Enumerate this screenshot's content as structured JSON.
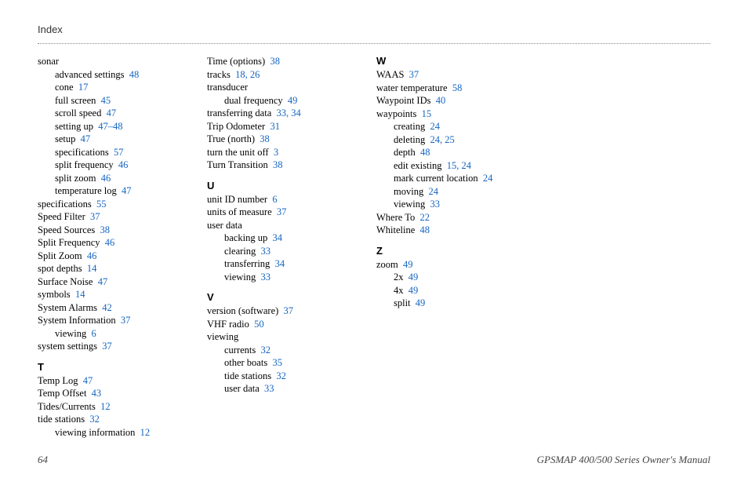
{
  "header": {
    "title": "Index"
  },
  "footer": {
    "page_number": "64",
    "manual_title": "GPSMAP 400/500 Series Owner's Manual"
  },
  "columns": [
    {
      "items": [
        {
          "type": "entry",
          "indent": 0,
          "text": "sonar",
          "pages": ""
        },
        {
          "type": "entry",
          "indent": 1,
          "text": "advanced settings",
          "pages": "48"
        },
        {
          "type": "entry",
          "indent": 1,
          "text": "cone",
          "pages": "17"
        },
        {
          "type": "entry",
          "indent": 1,
          "text": "full screen",
          "pages": "45"
        },
        {
          "type": "entry",
          "indent": 1,
          "text": "scroll speed",
          "pages": "47"
        },
        {
          "type": "entry",
          "indent": 1,
          "text": "setting up",
          "pages": "47–48"
        },
        {
          "type": "entry",
          "indent": 1,
          "text": "setup",
          "pages": "47"
        },
        {
          "type": "entry",
          "indent": 1,
          "text": "specifications",
          "pages": "57"
        },
        {
          "type": "entry",
          "indent": 1,
          "text": "split frequency",
          "pages": "46"
        },
        {
          "type": "entry",
          "indent": 1,
          "text": "split zoom",
          "pages": "46"
        },
        {
          "type": "entry",
          "indent": 1,
          "text": "temperature log",
          "pages": "47"
        },
        {
          "type": "entry",
          "indent": 0,
          "text": "specifications",
          "pages": "55"
        },
        {
          "type": "entry",
          "indent": 0,
          "text": "Speed Filter",
          "pages": "37"
        },
        {
          "type": "entry",
          "indent": 0,
          "text": "Speed Sources",
          "pages": "38"
        },
        {
          "type": "entry",
          "indent": 0,
          "text": "Split Frequency",
          "pages": "46"
        },
        {
          "type": "entry",
          "indent": 0,
          "text": "Split Zoom",
          "pages": "46"
        },
        {
          "type": "entry",
          "indent": 0,
          "text": "spot depths",
          "pages": "14"
        },
        {
          "type": "entry",
          "indent": 0,
          "text": "Surface Noise",
          "pages": "47"
        },
        {
          "type": "entry",
          "indent": 0,
          "text": "symbols",
          "pages": "14"
        },
        {
          "type": "entry",
          "indent": 0,
          "text": "System Alarms",
          "pages": "42"
        },
        {
          "type": "entry",
          "indent": 0,
          "text": "System Information",
          "pages": "37"
        },
        {
          "type": "entry",
          "indent": 1,
          "text": "viewing",
          "pages": "6"
        },
        {
          "type": "entry",
          "indent": 0,
          "text": "system settings",
          "pages": "37"
        },
        {
          "type": "section",
          "text": "T"
        },
        {
          "type": "entry",
          "indent": 0,
          "text": "Temp Log",
          "pages": "47"
        },
        {
          "type": "entry",
          "indent": 0,
          "text": "Temp Offset",
          "pages": "43"
        },
        {
          "type": "entry",
          "indent": 0,
          "text": "Tides/Currents",
          "pages": "12"
        },
        {
          "type": "entry",
          "indent": 0,
          "text": "tide stations",
          "pages": "32"
        },
        {
          "type": "entry",
          "indent": 1,
          "text": "viewing information",
          "pages": "12"
        }
      ]
    },
    {
      "items": [
        {
          "type": "entry",
          "indent": 0,
          "text": "Time (options)",
          "pages": "38"
        },
        {
          "type": "entry",
          "indent": 0,
          "text": "tracks",
          "pages": "18, 26"
        },
        {
          "type": "entry",
          "indent": 0,
          "text": "transducer",
          "pages": ""
        },
        {
          "type": "entry",
          "indent": 1,
          "text": "dual frequency",
          "pages": "49"
        },
        {
          "type": "entry",
          "indent": 0,
          "text": "transferring data",
          "pages": "33, 34"
        },
        {
          "type": "entry",
          "indent": 0,
          "text": "Trip Odometer",
          "pages": "31"
        },
        {
          "type": "entry",
          "indent": 0,
          "text": "True (north)",
          "pages": "38"
        },
        {
          "type": "entry",
          "indent": 0,
          "text": "turn the unit off",
          "pages": "3"
        },
        {
          "type": "entry",
          "indent": 0,
          "text": "Turn Transition",
          "pages": "38"
        },
        {
          "type": "section",
          "text": "U"
        },
        {
          "type": "entry",
          "indent": 0,
          "text": "unit ID number",
          "pages": "6"
        },
        {
          "type": "entry",
          "indent": 0,
          "text": "units of measure",
          "pages": "37"
        },
        {
          "type": "entry",
          "indent": 0,
          "text": "user data",
          "pages": ""
        },
        {
          "type": "entry",
          "indent": 1,
          "text": "backing up",
          "pages": "34"
        },
        {
          "type": "entry",
          "indent": 1,
          "text": "clearing",
          "pages": "33"
        },
        {
          "type": "entry",
          "indent": 1,
          "text": "transferring",
          "pages": "34"
        },
        {
          "type": "entry",
          "indent": 1,
          "text": "viewing",
          "pages": "33"
        },
        {
          "type": "section",
          "text": "V"
        },
        {
          "type": "entry",
          "indent": 0,
          "text": "version (software)",
          "pages": "37"
        },
        {
          "type": "entry",
          "indent": 0,
          "text": "VHF radio",
          "pages": "50"
        },
        {
          "type": "entry",
          "indent": 0,
          "text": "viewing",
          "pages": ""
        },
        {
          "type": "entry",
          "indent": 1,
          "text": "currents",
          "pages": "32"
        },
        {
          "type": "entry",
          "indent": 1,
          "text": "other boats",
          "pages": "35"
        },
        {
          "type": "entry",
          "indent": 1,
          "text": "tide stations",
          "pages": "32"
        },
        {
          "type": "entry",
          "indent": 1,
          "text": "user data",
          "pages": "33"
        }
      ]
    },
    {
      "items": [
        {
          "type": "section",
          "text": "W",
          "first": true
        },
        {
          "type": "entry",
          "indent": 0,
          "text": "WAAS",
          "pages": "37"
        },
        {
          "type": "entry",
          "indent": 0,
          "text": "water temperature",
          "pages": "58"
        },
        {
          "type": "entry",
          "indent": 0,
          "text": "Waypoint IDs",
          "pages": "40"
        },
        {
          "type": "entry",
          "indent": 0,
          "text": "waypoints",
          "pages": "15"
        },
        {
          "type": "entry",
          "indent": 1,
          "text": "creating",
          "pages": "24"
        },
        {
          "type": "entry",
          "indent": 1,
          "text": "deleting",
          "pages": "24, 25"
        },
        {
          "type": "entry",
          "indent": 1,
          "text": "depth",
          "pages": "48"
        },
        {
          "type": "entry",
          "indent": 1,
          "text": "edit existing",
          "pages": "15, 24"
        },
        {
          "type": "entry",
          "indent": 1,
          "text": "mark current location",
          "pages": "24"
        },
        {
          "type": "entry",
          "indent": 1,
          "text": "moving",
          "pages": "24"
        },
        {
          "type": "entry",
          "indent": 1,
          "text": "viewing",
          "pages": "33"
        },
        {
          "type": "entry",
          "indent": 0,
          "text": "Where To",
          "pages": "22"
        },
        {
          "type": "entry",
          "indent": 0,
          "text": "Whiteline",
          "pages": "48"
        },
        {
          "type": "section",
          "text": "Z"
        },
        {
          "type": "entry",
          "indent": 0,
          "text": "zoom",
          "pages": "49"
        },
        {
          "type": "entry",
          "indent": 1,
          "text": "2x",
          "pages": "49"
        },
        {
          "type": "entry",
          "indent": 1,
          "text": "4x",
          "pages": "49"
        },
        {
          "type": "entry",
          "indent": 1,
          "text": "split",
          "pages": "49"
        }
      ]
    }
  ]
}
